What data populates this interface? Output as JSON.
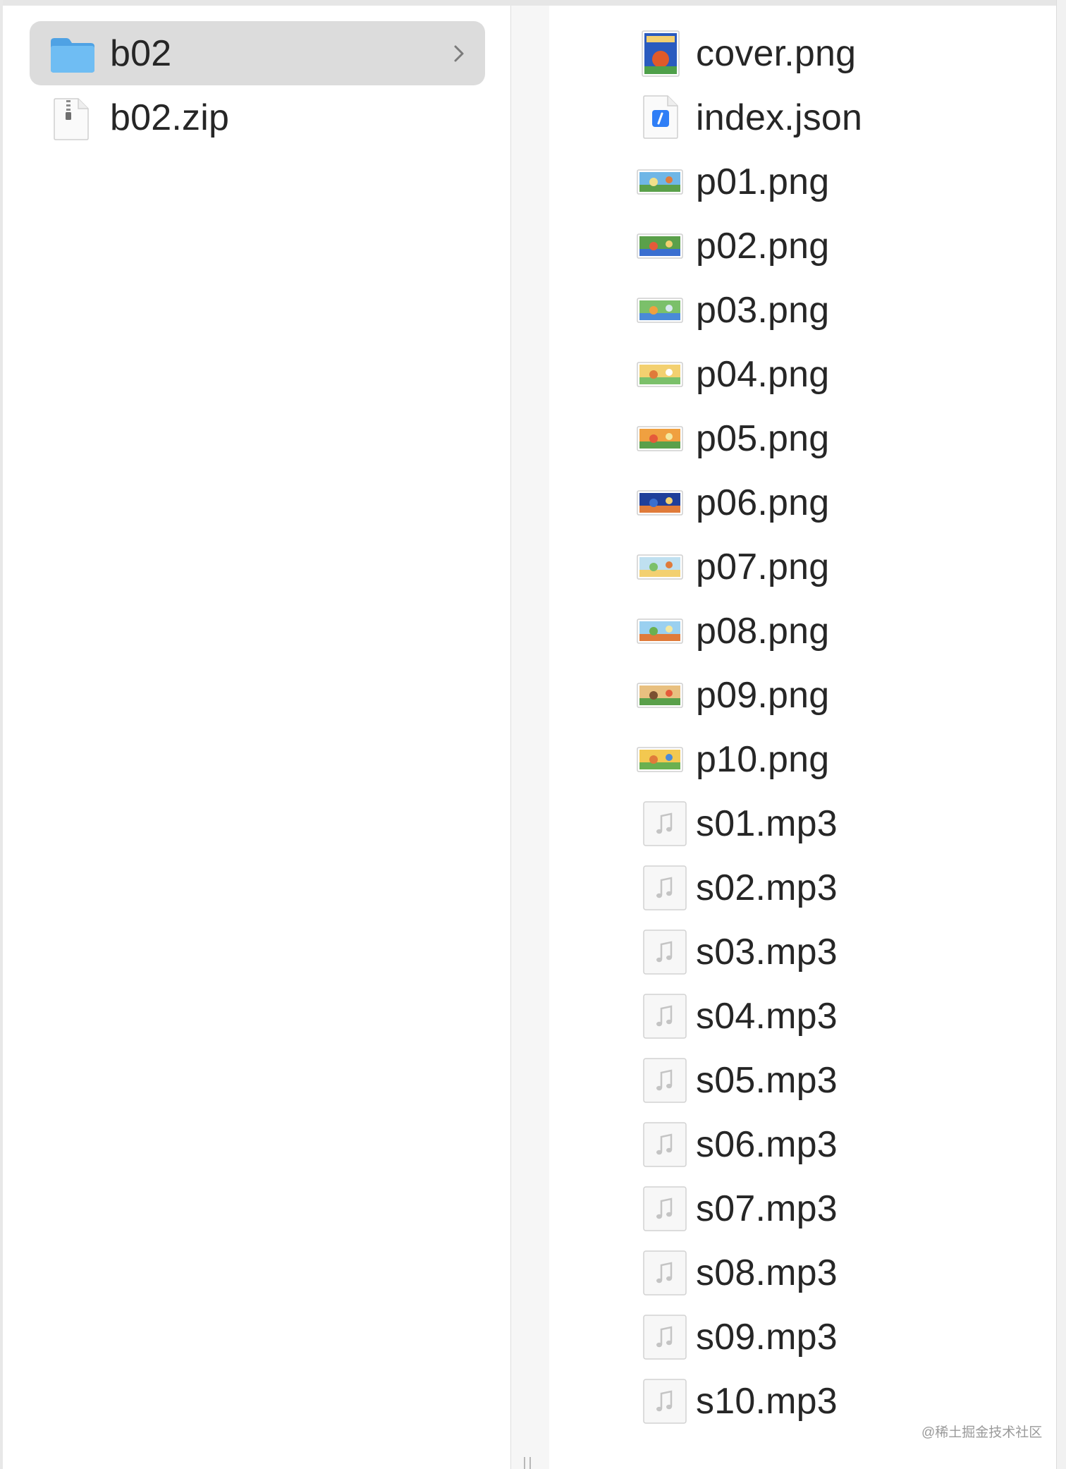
{
  "column1": {
    "items": [
      {
        "label": "b02",
        "icon": "folder-icon",
        "selected": true,
        "has_children": true
      },
      {
        "label": "b02.zip",
        "icon": "zip-archive-icon",
        "selected": false,
        "has_children": false
      }
    ]
  },
  "column2": {
    "items": [
      {
        "label": "cover.png",
        "icon": "image-thumbnail-icon"
      },
      {
        "label": "index.json",
        "icon": "json-file-icon"
      },
      {
        "label": "p01.png",
        "icon": "image-thumbnail-icon"
      },
      {
        "label": "p02.png",
        "icon": "image-thumbnail-icon"
      },
      {
        "label": "p03.png",
        "icon": "image-thumbnail-icon"
      },
      {
        "label": "p04.png",
        "icon": "image-thumbnail-icon"
      },
      {
        "label": "p05.png",
        "icon": "image-thumbnail-icon"
      },
      {
        "label": "p06.png",
        "icon": "image-thumbnail-icon"
      },
      {
        "label": "p07.png",
        "icon": "image-thumbnail-icon"
      },
      {
        "label": "p08.png",
        "icon": "image-thumbnail-icon"
      },
      {
        "label": "p09.png",
        "icon": "image-thumbnail-icon"
      },
      {
        "label": "p10.png",
        "icon": "image-thumbnail-icon"
      },
      {
        "label": "s01.mp3",
        "icon": "audio-file-icon"
      },
      {
        "label": "s02.mp3",
        "icon": "audio-file-icon"
      },
      {
        "label": "s03.mp3",
        "icon": "audio-file-icon"
      },
      {
        "label": "s04.mp3",
        "icon": "audio-file-icon"
      },
      {
        "label": "s05.mp3",
        "icon": "audio-file-icon"
      },
      {
        "label": "s06.mp3",
        "icon": "audio-file-icon"
      },
      {
        "label": "s07.mp3",
        "icon": "audio-file-icon"
      },
      {
        "label": "s08.mp3",
        "icon": "audio-file-icon"
      },
      {
        "label": "s09.mp3",
        "icon": "audio-file-icon"
      },
      {
        "label": "s10.mp3",
        "icon": "audio-file-icon"
      }
    ]
  },
  "watermark": "@稀土掘金技术社区",
  "colors": {
    "selection": "#dcdcdc",
    "folder": "#5fb0ec",
    "json_badge": "#2f7ef6",
    "text": "#262626"
  }
}
